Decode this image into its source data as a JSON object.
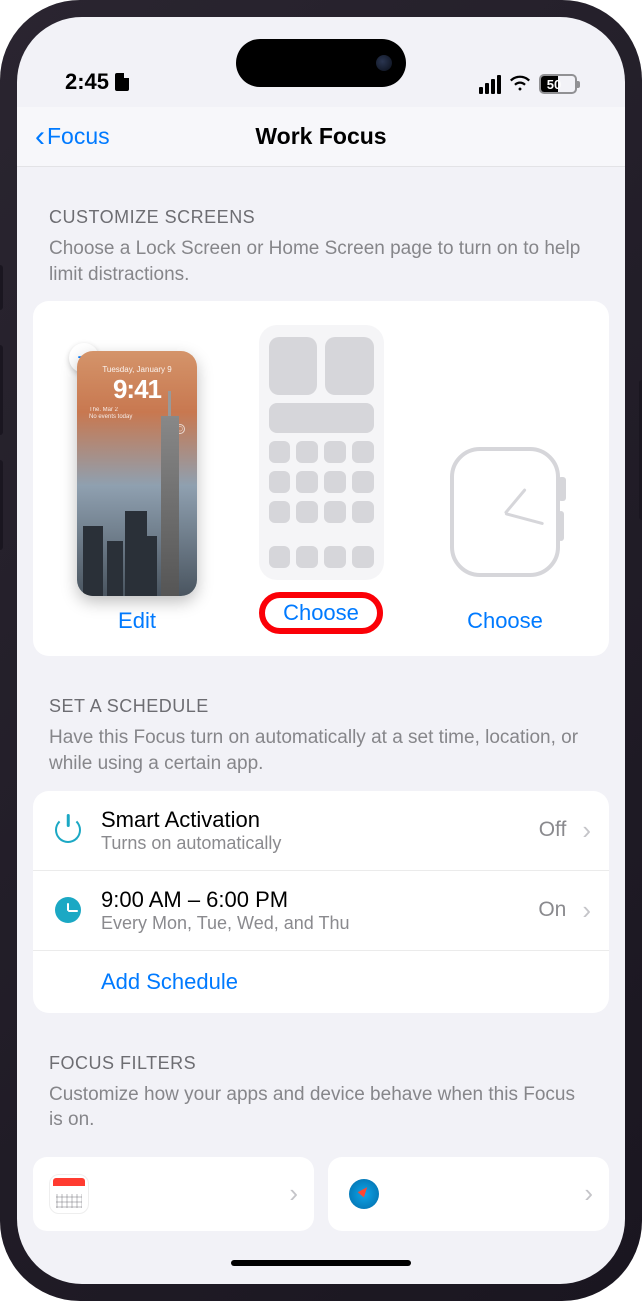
{
  "status": {
    "time": "2:45",
    "battery": "50"
  },
  "nav": {
    "back": "Focus",
    "title": "Work Focus"
  },
  "customize": {
    "header": "CUSTOMIZE SCREENS",
    "subtext": "Choose a Lock Screen or Home Screen page to turn on to help limit distractions.",
    "lock": {
      "date": "Tuesday, January 9",
      "time": "9:41",
      "sub1": "The. Mar 2",
      "sub2": "No events today",
      "action": "Edit"
    },
    "home": {
      "action": "Choose"
    },
    "watch": {
      "action": "Choose"
    }
  },
  "schedule": {
    "header": "SET A SCHEDULE",
    "subtext": "Have this Focus turn on automatically at a set time, location, or while using a certain app.",
    "smart": {
      "title": "Smart Activation",
      "sub": "Turns on automatically",
      "value": "Off"
    },
    "time": {
      "title": "9:00 AM – 6:00 PM",
      "sub": "Every Mon, Tue, Wed, and Thu",
      "value": "On"
    },
    "add": "Add Schedule"
  },
  "filters": {
    "header": "FOCUS FILTERS",
    "subtext": "Customize how your apps and device behave when this Focus is on."
  }
}
